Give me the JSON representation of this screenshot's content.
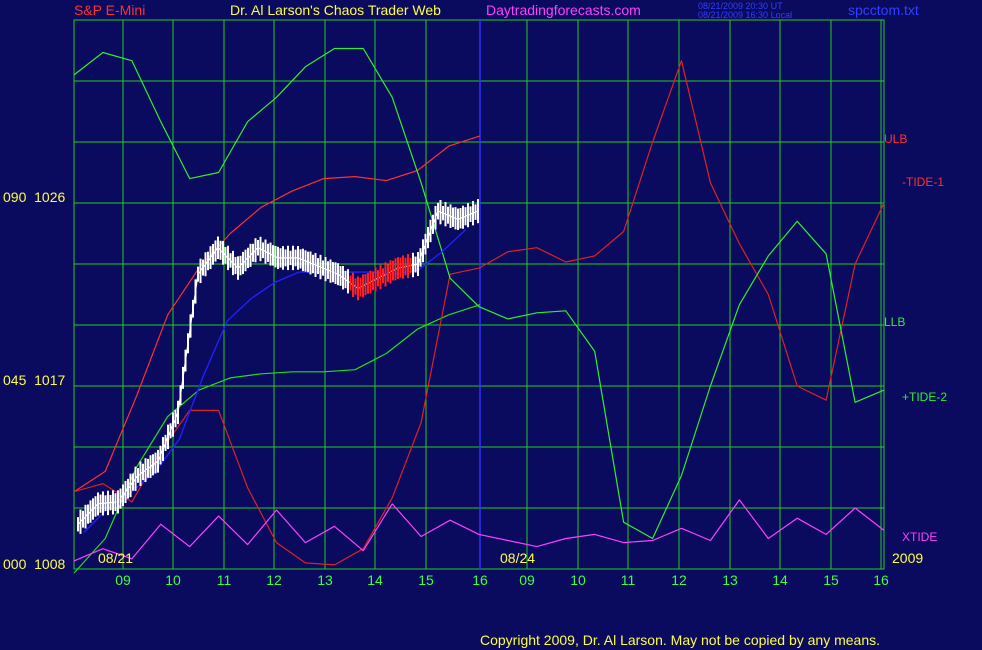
{
  "header": {
    "instrument": "S&P E-Mini",
    "title": "Dr. Al Larson's Chaos Trader Web",
    "site": "Daytradingforecasts.com",
    "stamp_line1": "08/21/2009 20:30 UT",
    "stamp_line2": "08/21/2009 16:30 Local",
    "file": "spcctom.txt"
  },
  "copyright": "Copyright 2009, Dr. Al Larson. May not be copied by any means.",
  "colors": {
    "background": "#0a0a5e",
    "grid": "#22cc22",
    "axis_text": "#ffff40",
    "price_bars": "#ffffff",
    "price_bars_down": "#ff2020",
    "ulb": "#ff3030",
    "tide1": "#dd2222",
    "llb": "#22dd22",
    "tide2": "#30ee30",
    "xtide": "#ff40ff",
    "moving_average": "#2020ff",
    "divider": "#3030ff"
  },
  "chart_data": {
    "type": "line",
    "title": "S&P E-Mini",
    "y_axis_labels": [
      {
        "code": "000",
        "price": 1008
      },
      {
        "code": "045",
        "price": 1017
      },
      {
        "code": "090",
        "price": 1026
      }
    ],
    "ylim": [
      1008,
      1026
    ],
    "x_hour_ticks": [
      "09",
      "10",
      "11",
      "12",
      "13",
      "14",
      "15",
      "16",
      "09",
      "10",
      "11",
      "12",
      "13",
      "14",
      "15",
      "16"
    ],
    "date_labels": [
      "08/21",
      "08/24",
      "2009"
    ],
    "grid": true,
    "series": [
      {
        "name": "ULB",
        "color": "#ff3030",
        "y": [
          1011.8,
          1012.8,
          1016.5,
          1020.5,
          1022.8,
          1024.5,
          1025.8,
          1026.6,
          1027.2,
          1027.3,
          1027.1,
          1027.6,
          1028.8,
          1029.3
        ]
      },
      {
        "name": "LLB",
        "color": "#22dd22",
        "y": [
          1007.8,
          1009.5,
          1013.0,
          1015.5,
          1016.8,
          1017.4,
          1017.6,
          1017.7,
          1017.7,
          1017.8,
          1018.6,
          1019.8,
          1020.5,
          1021.0
        ]
      },
      {
        "name": "-TIDE-1",
        "color": "#dd2222",
        "y": [
          1011.8,
          1012.2,
          1011.3,
          1013.8,
          1015.8,
          1015.8,
          1012.0,
          1009.3,
          1008.3,
          1008.2,
          1009.0,
          1011.5,
          1015.2,
          1022.5,
          1022.8,
          1023.6,
          1023.8,
          1023.1,
          1023.4,
          1024.6,
          1029.0,
          1033.0,
          1027.0,
          1024.0,
          1021.5,
          1017.0,
          1016.3,
          1023.0,
          1026.0
        ]
      },
      {
        "name": "+TIDE-2",
        "color": "#30ee30",
        "y": [
          1032.3,
          1033.4,
          1033.0,
          1030.0,
          1027.2,
          1027.5,
          1030.0,
          1031.2,
          1032.7,
          1033.6,
          1033.6,
          1031.2,
          1027.0,
          1022.3,
          1020.9,
          1020.3,
          1020.6,
          1020.7,
          1018.7,
          1010.3,
          1009.5,
          1012.6,
          1017.0,
          1021.0,
          1023.4,
          1025.1,
          1023.5,
          1016.2,
          1016.8
        ]
      },
      {
        "name": "XTIDE",
        "color": "#ff40ff",
        "y": [
          1008.4,
          1009.0,
          1008.5,
          1010.2,
          1009.1,
          1010.6,
          1009.2,
          1010.9,
          1009.3,
          1010.1,
          1008.9,
          1011.2,
          1009.6,
          1010.4,
          1009.7,
          1009.4,
          1009.1,
          1009.5,
          1009.7,
          1009.3,
          1009.4,
          1010.0,
          1009.4,
          1011.4,
          1009.5,
          1010.5,
          1009.7,
          1011.0,
          1009.9
        ]
      },
      {
        "name": "Price",
        "color": "#ffffff",
        "y": [
          1010.2,
          1011.2,
          1011.3,
          1012.6,
          1013.3,
          1015.7,
          1022.5,
          1023.8,
          1022.8,
          1023.8,
          1023.3,
          1023.3,
          1022.9,
          1022.5,
          1021.8,
          1022.3,
          1022.8,
          1023.0,
          1025.6,
          1025.2,
          1025.6
        ]
      },
      {
        "name": "Moving Average",
        "color": "#2020ff",
        "y": [
          1009.8,
          1011.0,
          1011.8,
          1012.8,
          1014.4,
          1017.5,
          1020.2,
          1021.3,
          1022.1,
          1022.6,
          1022.6,
          1022.6,
          1022.6,
          1022.5,
          1022.7,
          1023.6,
          1024.7
        ]
      }
    ]
  },
  "right_labels": [
    "ULB",
    "-TIDE-1",
    "LLB",
    "+TIDE-2",
    "XTIDE"
  ]
}
